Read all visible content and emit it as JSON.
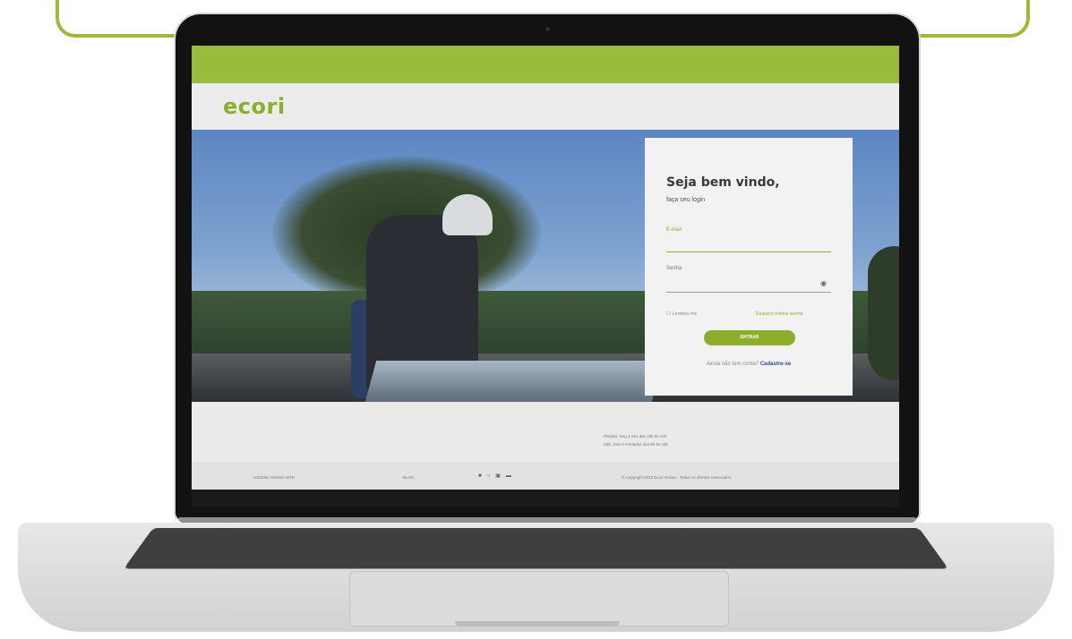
{
  "brand": {
    "logo": "ecori",
    "accent": "#8cae2c"
  },
  "login": {
    "title": "Seja bem vindo,",
    "subtitle": "faça seu login",
    "email_label": "E-mail",
    "password_label": "Senha",
    "remember_label": "Lembre-me",
    "forgot_label": "Esqueci minha senha",
    "submit_label": "ENTRAR",
    "no_account_text": "Ainda não tem conta?",
    "signup_link": "Cadastre-se"
  },
  "hours": {
    "line1": "Plantão: Seg à Sex das 18h às 22h",
    "line2": "Sáb, Dom e Feriados das 8h às 18h"
  },
  "footer": {
    "site_link": "ACESSE NOSSO SITE",
    "blog_link": "BLOG",
    "social_icons": [
      "facebook-icon",
      "instagram-icon",
      "linkedin-icon",
      "youtube-icon"
    ],
    "copyright": "© Copyright 2022 Ecori Online - Todos os direitos reservados."
  }
}
